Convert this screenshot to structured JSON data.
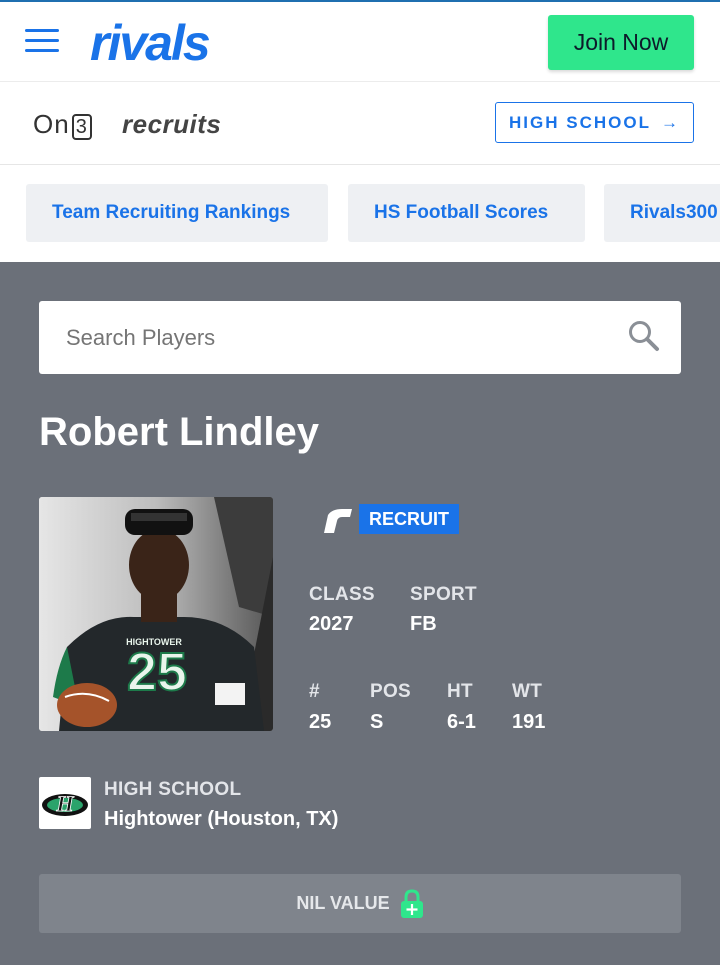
{
  "header": {
    "logo_text": "rivals",
    "join_label": "Join Now"
  },
  "subheader": {
    "on3_text": "On",
    "on3_digit": "3",
    "recruits_text": "recruits",
    "high_school_label": "HIGH SCHOOL",
    "arrow": "→"
  },
  "pills": [
    {
      "label": "Team Recruiting Rankings"
    },
    {
      "label": "HS Football Scores"
    },
    {
      "label": "Rivals300"
    }
  ],
  "search": {
    "placeholder": "Search Players"
  },
  "player": {
    "name": "Robert Lindley",
    "badge": "RECRUIT",
    "class_label": "CLASS",
    "class_value": "2027",
    "sport_label": "SPORT",
    "sport_value": "FB",
    "number_label": "#",
    "number_value": "25",
    "pos_label": "POS",
    "pos_value": "S",
    "ht_label": "HT",
    "ht_value": "6-1",
    "wt_label": "WT",
    "wt_value": "191",
    "jersey_text": "HIGHTOWER",
    "jersey_number": "25"
  },
  "school": {
    "label": "HIGH SCHOOL",
    "value": "Hightower (Houston, TX)"
  },
  "nil": {
    "label": "NIL VALUE"
  },
  "colors": {
    "brand_blue": "#1a73e8",
    "join_green": "#2fe68c",
    "panel_grey": "#6b7079",
    "nil_lock_green": "#2fe68c"
  },
  "icons": {
    "menu": "hamburger-menu-icon",
    "search": "magnifier-search-icon",
    "rivals_r": "rivals-r-icon",
    "nil_lock": "lock-plus-icon",
    "arrow": "arrow-right-icon"
  }
}
